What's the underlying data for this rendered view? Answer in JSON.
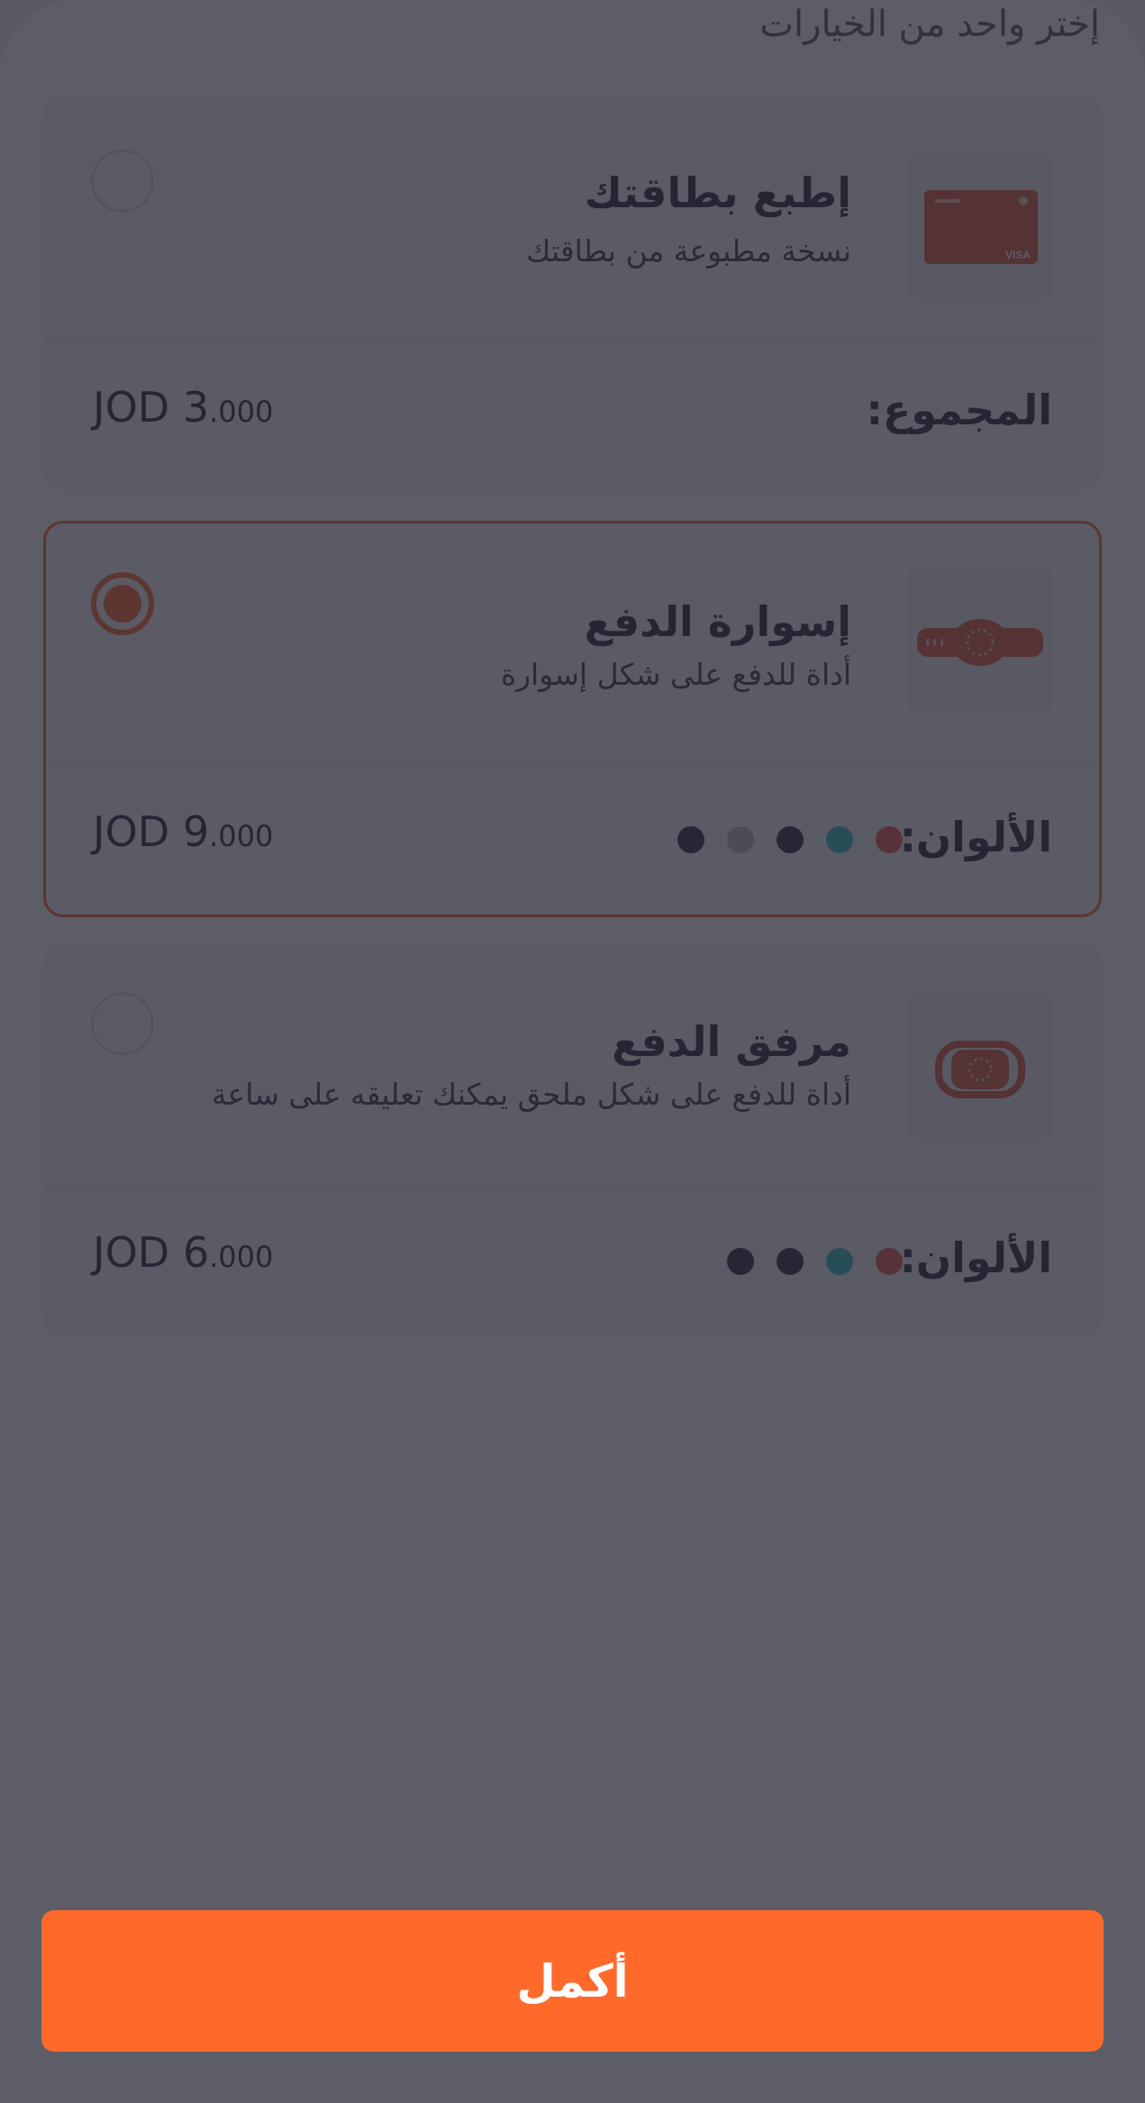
{
  "header": {
    "subtitle": "إختر واحد من الخيارات"
  },
  "options": [
    {
      "title": "إطبع بطاقتك",
      "description": "نسخة مطبوعة من بطاقتك",
      "bottom_label": "المجموع:",
      "price_currency": "JOD",
      "price_int": "3",
      "price_dec": ".000",
      "selected": false,
      "thumb_icon": "card-thumbnail-icon",
      "card_brand": "VISA"
    },
    {
      "title": "إسوارة الدفع",
      "description": "أداة للدفع على شكل إسوارة",
      "bottom_label": "الألوان:",
      "price_currency": "JOD",
      "price_int": "9",
      "price_dec": ".000",
      "selected": true,
      "thumb_icon": "bracelet-icon",
      "colors": [
        "#e8594a",
        "#33c2c0",
        "#2d2d45",
        "#bfbfc8",
        "#2d2d45"
      ]
    },
    {
      "title": "مرفق الدفع",
      "description": "أداة للدفع على شكل ملحق يمكنك تعليقه على ساعة",
      "bottom_label": "الألوان:",
      "price_currency": "JOD",
      "price_int": "6",
      "price_dec": ".000",
      "selected": false,
      "thumb_icon": "watch-attachment-icon",
      "colors": [
        "#e8594a",
        "#33c2c0",
        "#2d2d45",
        "#2d2d45"
      ]
    }
  ],
  "footer": {
    "button_label": "أكمل"
  },
  "theme": {
    "accent": "#ff6a2b",
    "overlay": "#242432"
  }
}
